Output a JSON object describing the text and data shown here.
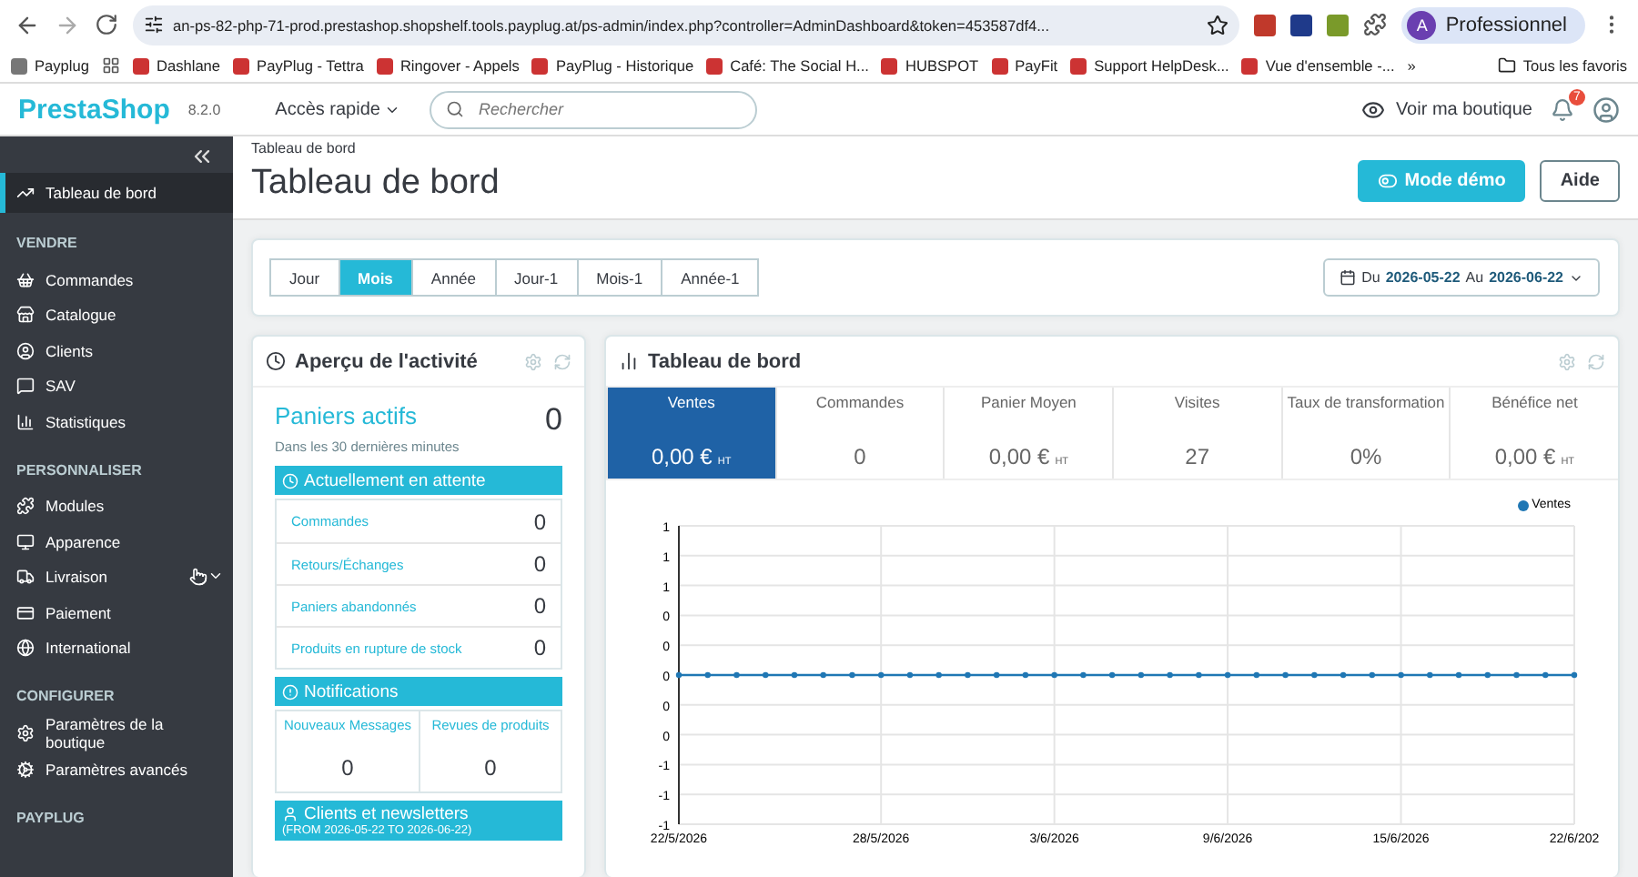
{
  "browser": {
    "url": "an-ps-82-php-71-prod.prestashop.shopshelf.tools.payplug.at/ps-admin/index.php?controller=AdminDashboard&token=453587df4...",
    "profile": {
      "initial": "A",
      "label": "Professionnel"
    },
    "bookmarks": [
      {
        "label": "Payplug"
      },
      {
        "label": "Dashlane"
      },
      {
        "label": "PayPlug - Tettra"
      },
      {
        "label": "Ringover - Appels"
      },
      {
        "label": "PayPlug - Historique"
      },
      {
        "label": "Café: The Social H..."
      },
      {
        "label": "HUBSPOT"
      },
      {
        "label": "PayFit"
      },
      {
        "label": "Support HelpDesk..."
      },
      {
        "label": "Vue d'ensemble -..."
      }
    ],
    "more": "»",
    "all_bookmarks": "Tous les favoris"
  },
  "header": {
    "logo": "PrestaShop",
    "version": "8.2.0",
    "quick_access": "Accès rapide",
    "search": {
      "placeholder": "Rechercher"
    },
    "view_shop": "Voir ma boutique",
    "notifications_count": "7"
  },
  "sidebar": {
    "sections": [
      {
        "items": [
          {
            "label": "Tableau de bord",
            "selected": true
          }
        ]
      },
      {
        "title": "VENDRE",
        "items": [
          {
            "label": "Commandes",
            "selected": false
          },
          {
            "label": "Catalogue",
            "selected": false
          },
          {
            "label": "Clients",
            "selected": false
          },
          {
            "label": "SAV",
            "selected": false
          },
          {
            "label": "Statistiques",
            "selected": false
          }
        ]
      },
      {
        "title": "PERSONNALISER",
        "items": [
          {
            "label": "Modules",
            "selected": false
          },
          {
            "label": "Apparence",
            "selected": false
          },
          {
            "label": "Livraison",
            "selected": false
          },
          {
            "label": "Paiement",
            "selected": false
          },
          {
            "label": "International",
            "selected": false
          }
        ]
      },
      {
        "title": "CONFIGURER",
        "items": [
          {
            "label": "Paramètres de la boutique",
            "selected": false
          },
          {
            "label": "Paramètres avancés",
            "selected": false
          }
        ]
      },
      {
        "title": "PAYPLUG"
      }
    ]
  },
  "page": {
    "breadcrumb": "Tableau de bord",
    "title": "Tableau de bord",
    "buttons": [
      {
        "label": "Mode démo",
        "kind": "primary"
      },
      {
        "label": "Aide",
        "kind": "default"
      }
    ]
  },
  "periods": [
    {
      "label": "Jour",
      "selected": false
    },
    {
      "label": "Mois",
      "selected": true
    },
    {
      "label": "Année",
      "selected": false
    },
    {
      "label": "Jour-1",
      "selected": false
    },
    {
      "label": "Mois-1",
      "selected": false
    },
    {
      "label": "Année-1",
      "selected": false
    }
  ],
  "date_range": {
    "from_label": "Du",
    "from": "2026-05-22",
    "to_label": "Au",
    "to": "2026-06-22"
  },
  "activity": {
    "title": "Aperçu de l'activité",
    "active_carts": {
      "label": "Paniers actifs",
      "sub": "Dans les 30 dernières minutes",
      "value": "0"
    },
    "pending": {
      "title": "Actuellement en attente",
      "rows": [
        {
          "label": "Commandes",
          "value": "0"
        },
        {
          "label": "Retours/Échanges",
          "value": "0"
        },
        {
          "label": "Paniers abandonnés",
          "value": "0"
        },
        {
          "label": "Produits en rupture de stock",
          "value": "0"
        }
      ]
    },
    "notifications": {
      "title": "Notifications",
      "cols": [
        {
          "label": "Nouveaux Messages",
          "value": "0"
        },
        {
          "label": "Revues de produits",
          "value": "0"
        }
      ]
    },
    "clients": {
      "title": "Clients et newsletters",
      "sub": "(FROM 2026-05-22 TO 2026-06-22)"
    }
  },
  "dashboard": {
    "title": "Tableau de bord",
    "kpis": [
      {
        "label": "Ventes",
        "value": "0,00 €",
        "unit": "HT",
        "selected": true
      },
      {
        "label": "Commandes",
        "value": "0",
        "selected": false
      },
      {
        "label": "Panier Moyen",
        "value": "0,00 €",
        "unit": "HT",
        "selected": false
      },
      {
        "label": "Visites",
        "value": "27",
        "selected": false
      },
      {
        "label": "Taux de transformation",
        "value": "0%",
        "selected": false
      },
      {
        "label": "Bénéfice net",
        "value": "0,00 €",
        "unit": "HT",
        "selected": false
      }
    ],
    "chart_data": {
      "type": "line",
      "categories": [
        "22/5/2026",
        null,
        null,
        null,
        null,
        null,
        null,
        "28/5/2026",
        null,
        null,
        null,
        null,
        null,
        "3/6/2026",
        null,
        null,
        null,
        null,
        null,
        "9/6/2026",
        null,
        null,
        null,
        null,
        null,
        "15/6/2026",
        null,
        null,
        null,
        null,
        null,
        "22/6/202"
      ],
      "series": [
        {
          "name": "Ventes",
          "color": "#1f77b4",
          "marker": "circle",
          "values": [
            0,
            0,
            0,
            0,
            0,
            0,
            0,
            0,
            0,
            0,
            0,
            0,
            0,
            0,
            0,
            0,
            0,
            0,
            0,
            0,
            0,
            0,
            0,
            0,
            0,
            0,
            0,
            0,
            0,
            0,
            0,
            0
          ]
        }
      ],
      "ylim": [
        -1,
        1
      ],
      "grid": true,
      "yticks": [
        {
          "value": 1,
          "label": "1"
        },
        {
          "value": 0.8,
          "label": "1"
        },
        {
          "value": 0.6,
          "label": "1"
        },
        {
          "value": 0.4,
          "label": "0"
        },
        {
          "value": 0.2,
          "label": "0"
        },
        {
          "value": 0,
          "label": "0"
        },
        {
          "value": -0.2,
          "label": "0"
        },
        {
          "value": -0.4,
          "label": "0"
        },
        {
          "value": -0.6,
          "label": "-1"
        },
        {
          "value": -0.8,
          "label": "-1"
        },
        {
          "value": -1,
          "label": "-1"
        }
      ]
    }
  }
}
